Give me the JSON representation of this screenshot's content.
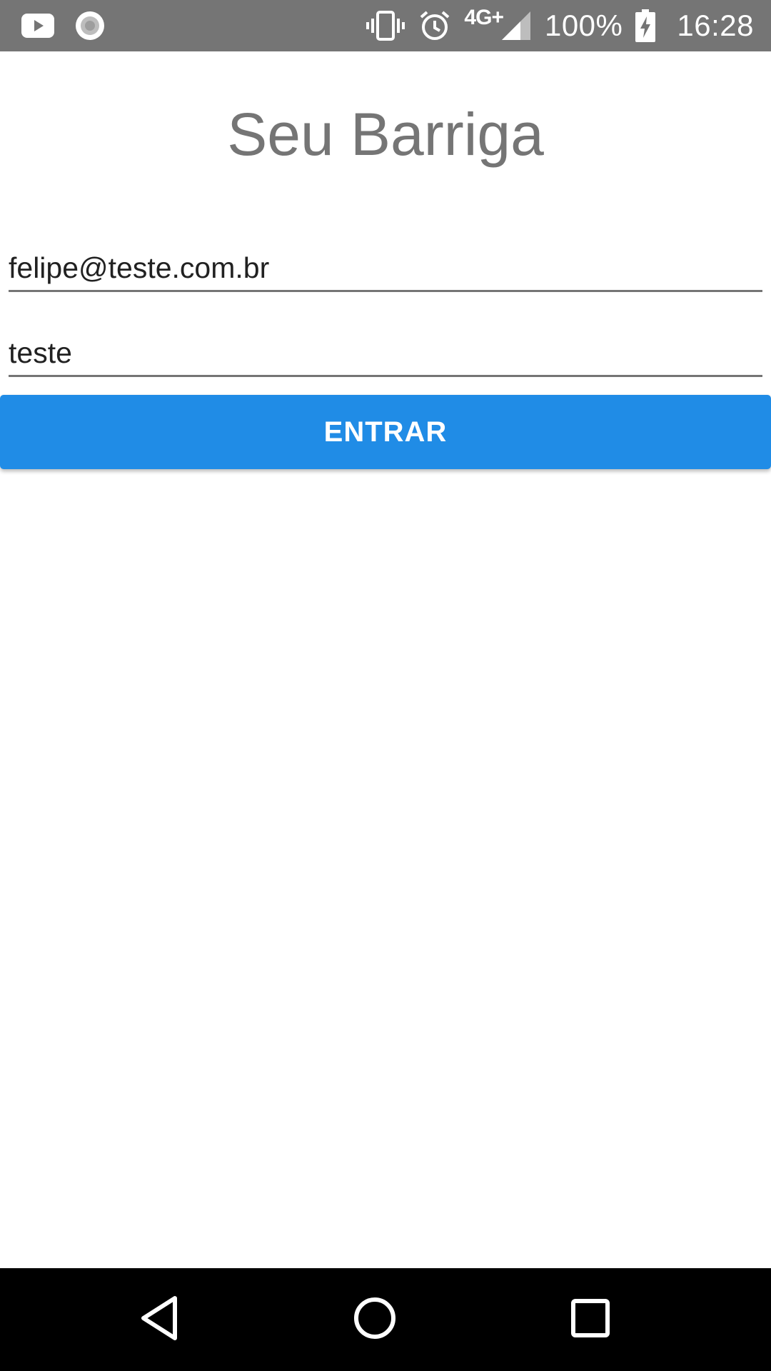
{
  "status_bar": {
    "left_icons": [
      "youtube-icon",
      "record-icon"
    ],
    "right_icons": [
      "vibrate-icon",
      "alarm-icon",
      "signal-icon",
      "battery-charging-icon"
    ],
    "network_type": "4G+",
    "battery_percent": "100%",
    "time": "16:28"
  },
  "app": {
    "title": "Seu Barriga"
  },
  "form": {
    "email_value": "felipe@teste.com.br",
    "password_value": "teste",
    "submit_label": "ENTRAR"
  },
  "nav_bar": {
    "buttons": [
      "back-icon",
      "home-icon",
      "recents-icon"
    ]
  },
  "colors": {
    "status_bar": "#757575",
    "title_text": "#757575",
    "button": "#208ce6",
    "nav_bar": "#000000"
  }
}
